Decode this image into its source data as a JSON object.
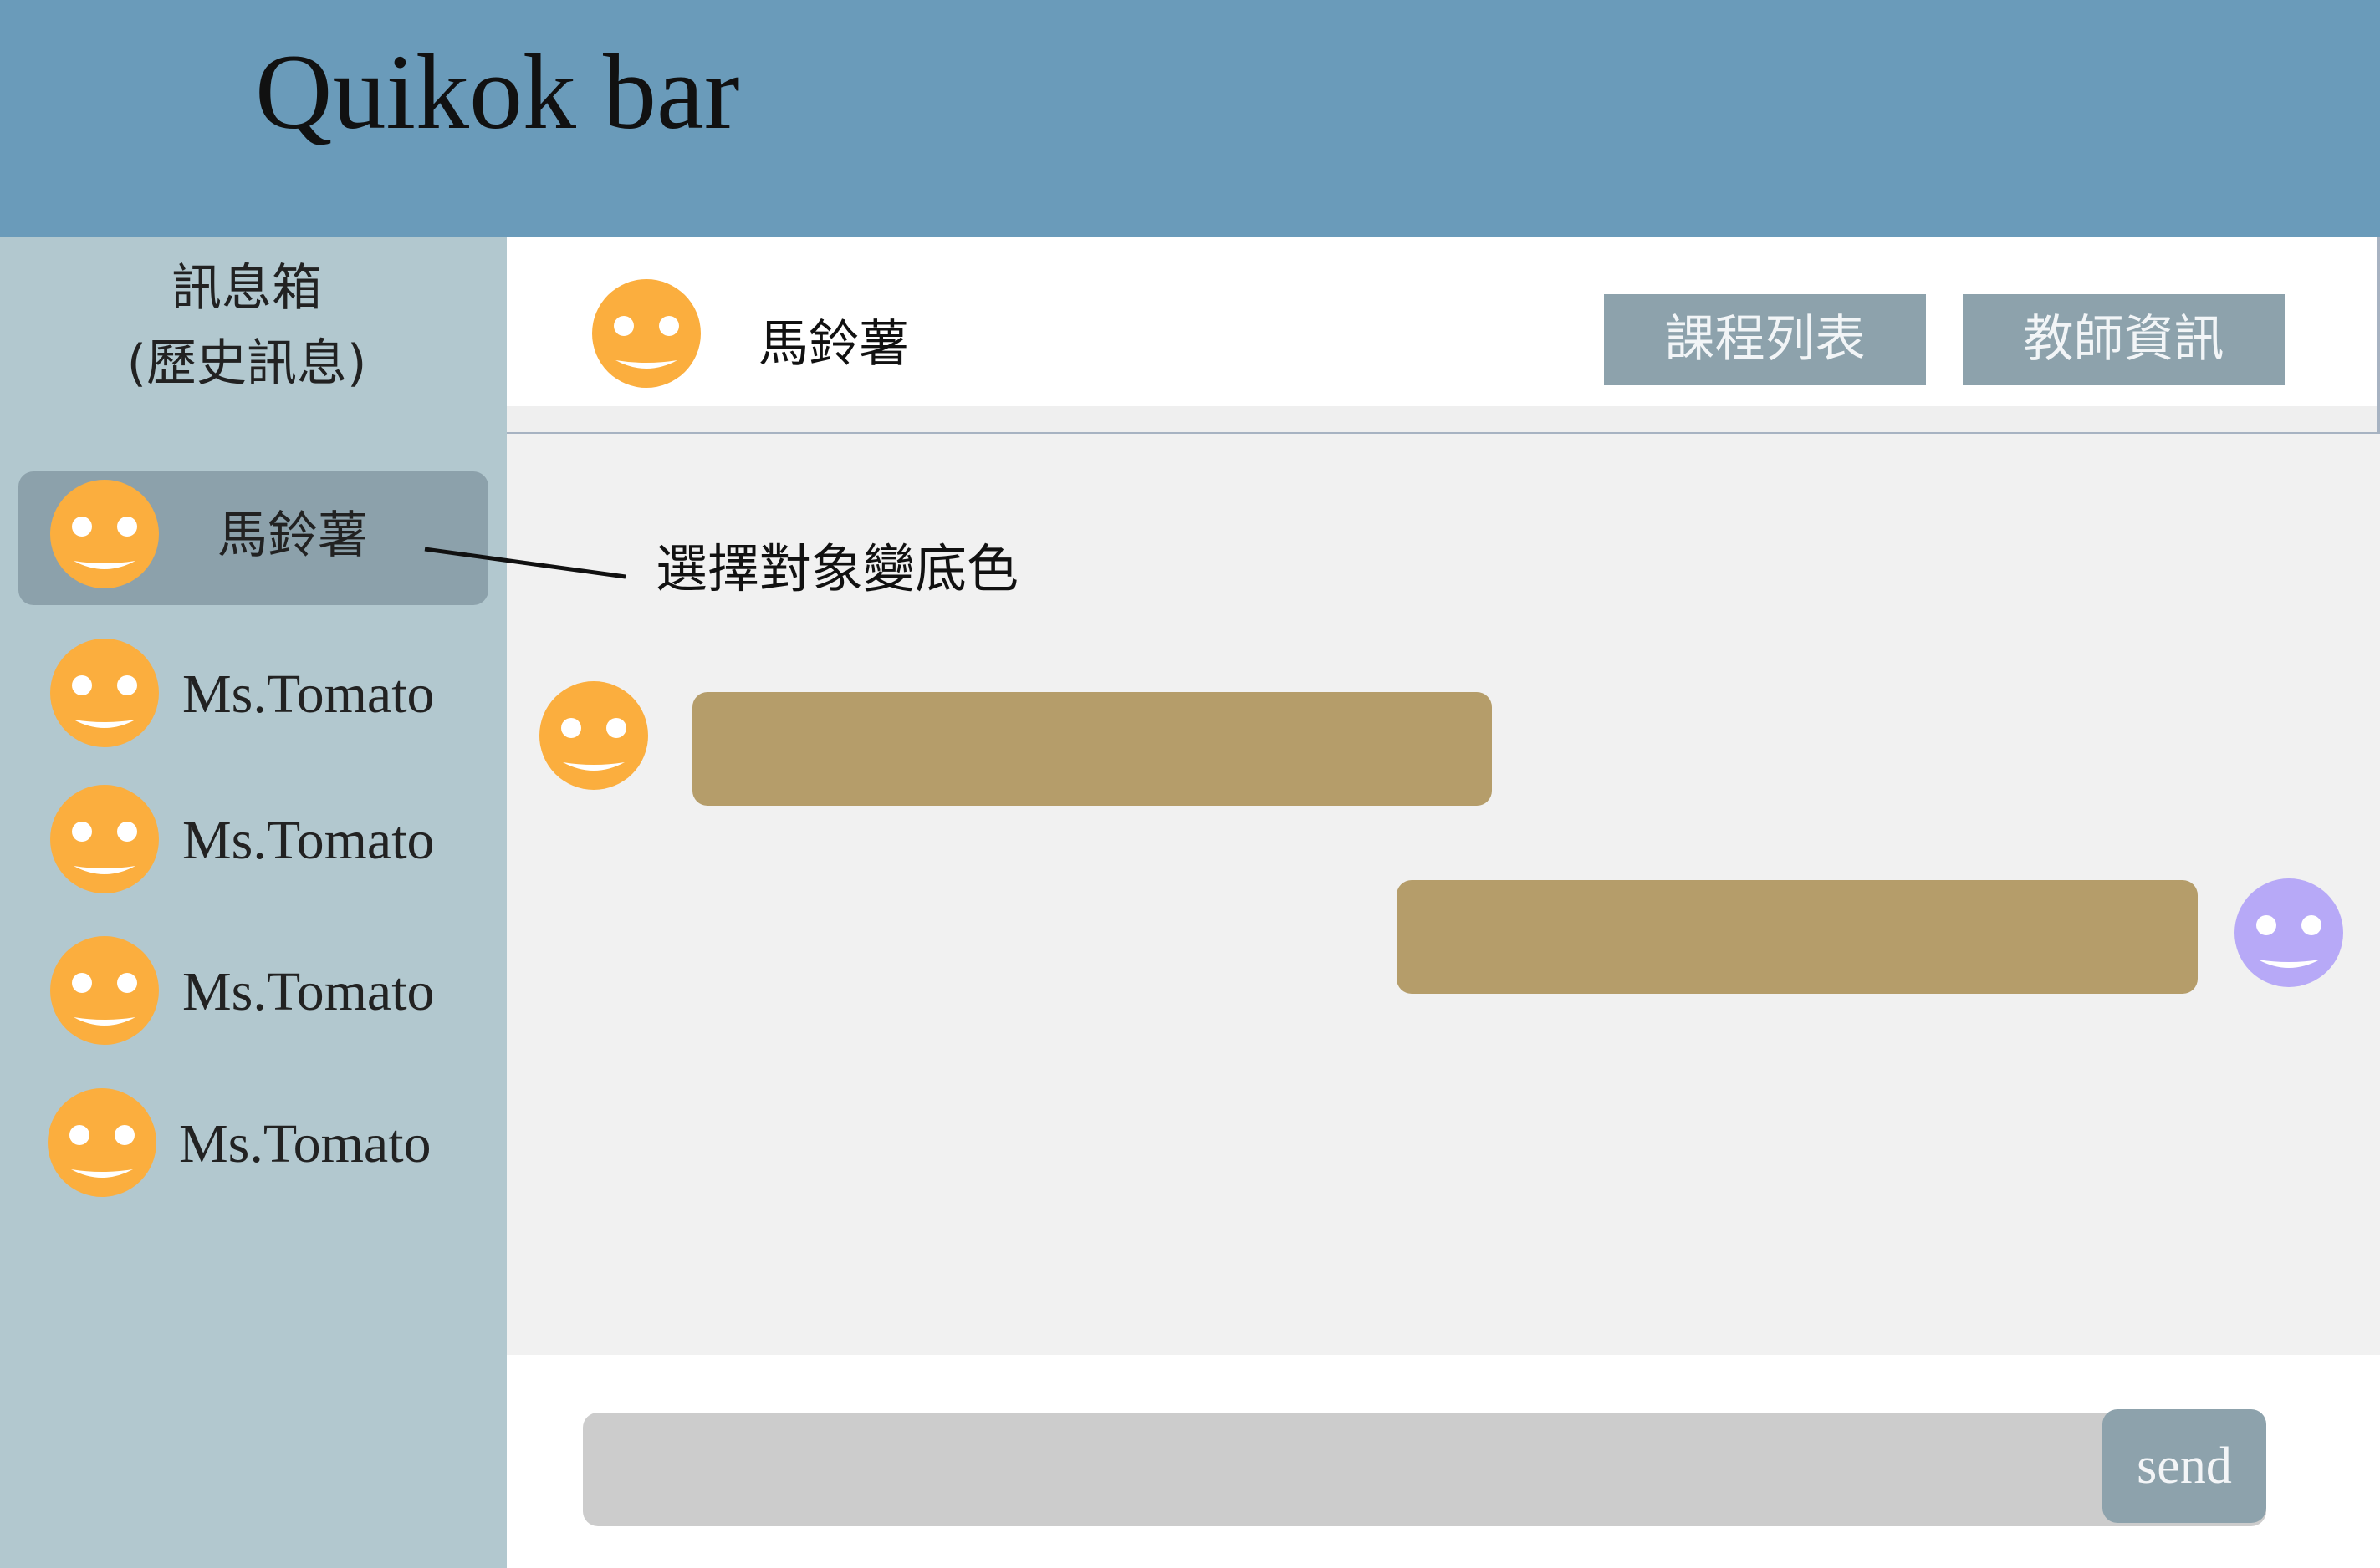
{
  "app": {
    "title": "Quikok bar"
  },
  "sidebar": {
    "title_line1": "訊息箱",
    "title_line2": "(歷史訊息)",
    "contacts": [
      {
        "name": "馬鈴薯",
        "selected": true,
        "avatar_icon": "smiley-face"
      },
      {
        "name": "Ms.Tomato",
        "selected": false,
        "avatar_icon": "smiley-face"
      },
      {
        "name": "Ms.Tomato",
        "selected": false,
        "avatar_icon": "smiley-face"
      },
      {
        "name": "Ms.Tomato",
        "selected": false,
        "avatar_icon": "smiley-face"
      },
      {
        "name": "Ms.Tomato",
        "selected": false,
        "avatar_icon": "smiley-face"
      }
    ]
  },
  "annotation": {
    "text": "選擇對象變底色"
  },
  "chat": {
    "header": {
      "contact_name": "馬鈴薯",
      "avatar_icon": "smiley-face",
      "buttons": [
        {
          "label": "課程列表"
        },
        {
          "label": "教師資訊"
        }
      ]
    },
    "composer": {
      "send_label": "send"
    }
  },
  "colors": {
    "header_bg": "#6a9bba",
    "sidebar_bg": "#b2c8cf",
    "selected_bg": "#8ca1ab",
    "button_bg": "#8da2ac",
    "chat_bg": "#f1f1f1",
    "input_bg": "#cccccc",
    "bubble_bg": "#b59d6a",
    "avatar_orange": "#fbae3e",
    "avatar_purple": "#b7a9f7"
  }
}
